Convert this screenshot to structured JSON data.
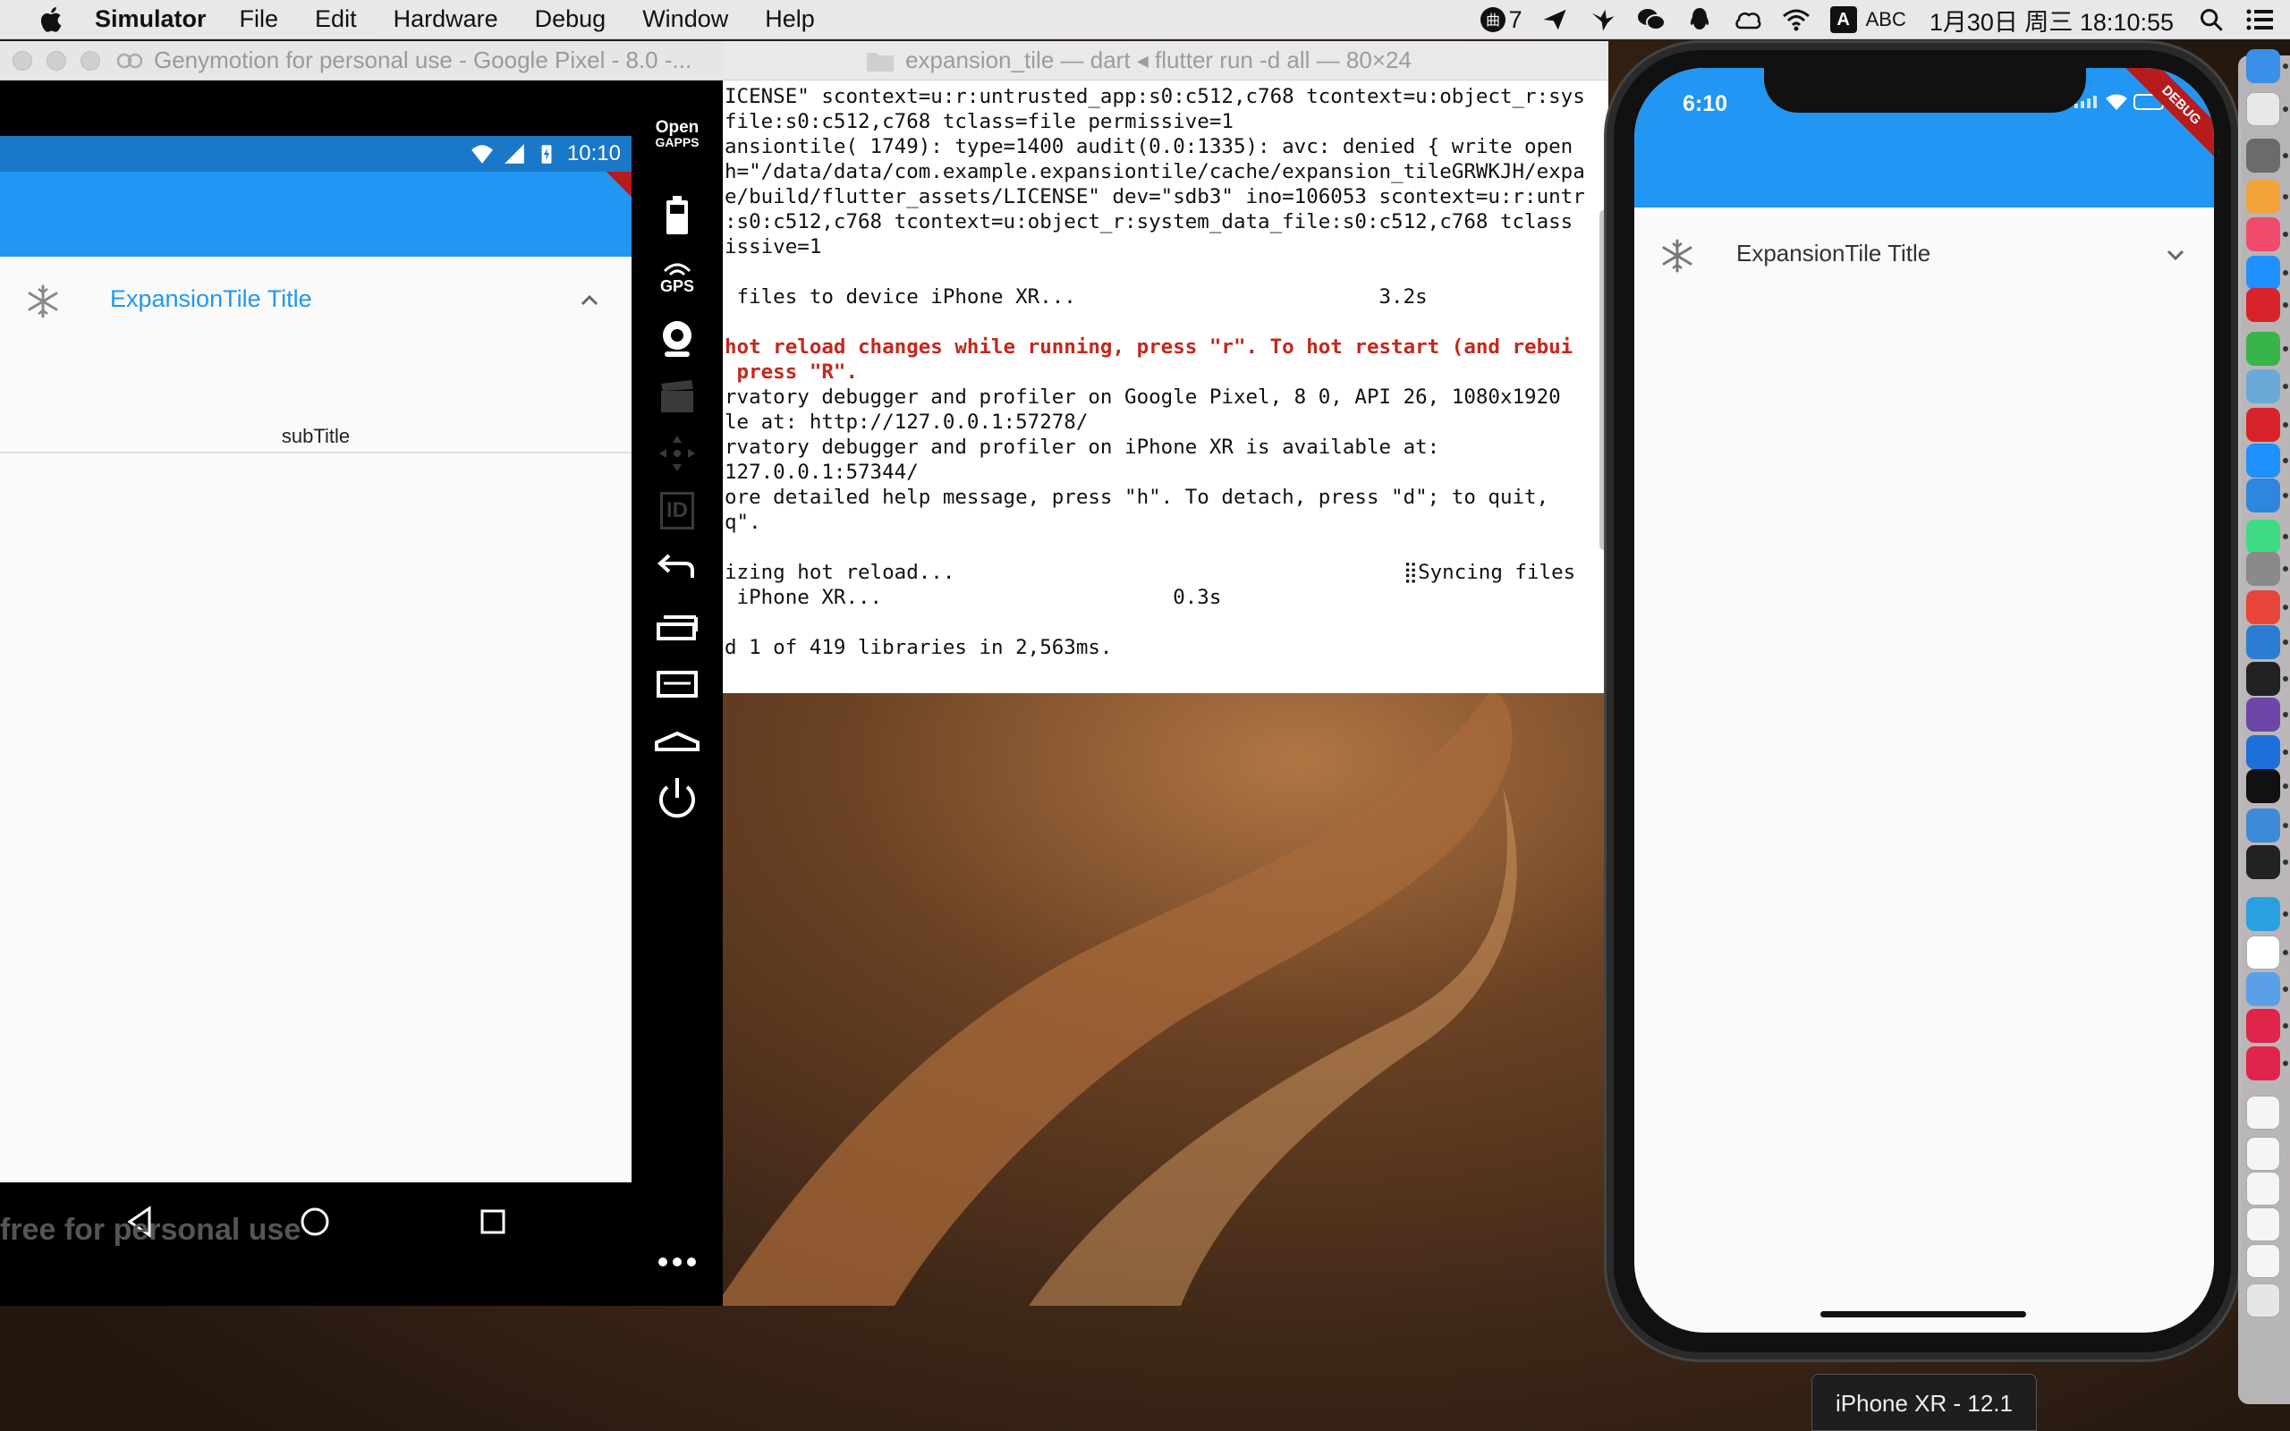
{
  "menubar": {
    "app_name": "Simulator",
    "menus": [
      "File",
      "Edit",
      "Hardware",
      "Debug",
      "Window",
      "Help"
    ],
    "status_badge_count": "7",
    "input_source": "A",
    "input_label": "ABC",
    "datetime": "1月30日 周三 18:10:55"
  },
  "genymotion": {
    "window_title": "Genymotion for personal use - Google Pixel - 8.0 -...",
    "status_time": "10:10",
    "debug_banner": "DEBUG",
    "tile_title": "ExpansionTile Title",
    "tile_subtitle": "subTitle",
    "watermark": "free for personal use",
    "toolbar": {
      "opengapps_line1": "Open",
      "opengapps_line2": "GAPPS",
      "gps": "GPS",
      "id": "ID"
    }
  },
  "terminal": {
    "window_title": "expansion_tile — dart ◂ flutter run -d all — 80×24",
    "lines": [
      "ICENSE\" scontext=u:r:untrusted_app:s0:c512,c768 tcontext=u:object_r:sys",
      "file:s0:c512,c768 tclass=file permissive=1",
      "ansiontile( 1749): type=1400 audit(0.0:1335): avc: denied { write open",
      "h=\"/data/data/com.example.expansiontile/cache/expansion_tileGRWKJH/expa",
      "e/build/flutter_assets/LICENSE\" dev=\"sdb3\" ino=106053 scontext=u:r:untr",
      ":s0:c512,c768 tcontext=u:object_r:system_data_file:s0:c512,c768 tclass",
      "issive=1",
      "",
      " files to device iPhone XR...                         3.2s",
      "",
      "hot reload changes while running, press \"r\". To hot restart (and rebui",
      " press \"R\".",
      "rvatory debugger and profiler on Google Pixel, 8 0, API 26, 1080x1920",
      "le at: http://127.0.0.1:57278/",
      "rvatory debugger and profiler on iPhone XR is available at:",
      "127.0.0.1:57344/",
      "ore detailed help message, press \"h\". To detach, press \"d\"; to quit,",
      "q\".",
      "",
      "izing hot reload...                                     ⣿Syncing files",
      " iPhone XR...                        0.3s",
      "",
      "d 1 of 419 libraries in 2,563ms."
    ],
    "red_line_indices": [
      10,
      11
    ]
  },
  "ios_simulator": {
    "status_time": "6:10",
    "debug_banner": "DEBUG",
    "tile_title": "ExpansionTile Title",
    "device_label": "iPhone XR - 12.1"
  },
  "colors": {
    "flutter_blue": "#2196f3",
    "debug_red": "#b71c1c",
    "terminal_red": "#c4281b"
  },
  "dock": {
    "items": [
      "finder-icon",
      "script-editor-icon",
      "launchpad-icon",
      "photos-icon",
      "itunes-icon",
      "app-store-icon",
      "netease-music-icon",
      "wechat-icon",
      "preview-icon",
      "youdao-icon",
      "safari-icon",
      "markdown-editor-icon",
      "android-studio-icon",
      "system-preferences-icon",
      "chrome-icon",
      "vscode-icon",
      "webstorm-icon",
      "github-desktop-icon",
      "maps-pin-icon",
      "qq-icon",
      "xcode-icon",
      "terminal-icon",
      "browser-icon",
      "feedback-icon",
      "xcode-simulator-icon",
      "genymotion-icon",
      "genymotion-player-icon",
      "doc-1-icon",
      "doc-2-icon",
      "doc-3-icon",
      "doc-4-icon",
      "doc-5-icon",
      "trash-icon"
    ]
  }
}
